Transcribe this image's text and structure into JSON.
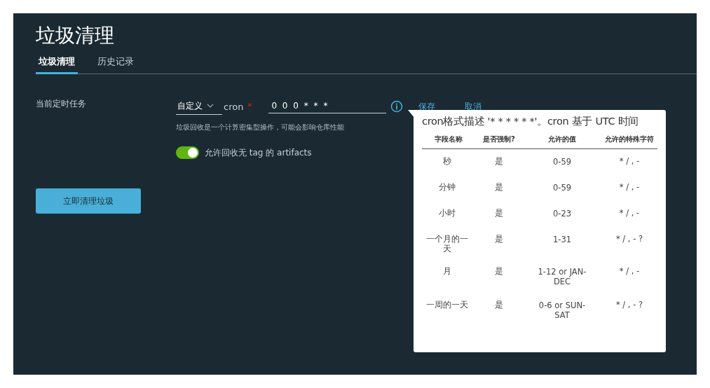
{
  "title": "垃圾清理",
  "tabs": [
    {
      "label": "垃圾清理",
      "selected": true
    },
    {
      "label": "历史记录",
      "selected": false
    }
  ],
  "schedule": {
    "label": "当前定时任务",
    "mode": "自定义",
    "cron_label": "cron",
    "required_mark": "*",
    "cron_value": "0 0 0 * * *",
    "hint": "垃圾回收是一个计算密集型操作，可能会影响仓库性能",
    "save": "保存",
    "cancel": "取消"
  },
  "toggle": {
    "label": "允许回收无 tag 的 artifacts",
    "on": true
  },
  "run_button": "立即清理垃圾",
  "tooltip": {
    "title": "cron格式描述 '* * * * * *'。cron 基于 UTC 时间",
    "columns": [
      "字段名称",
      "是否强制?",
      "允许的值",
      "允许的特殊字符"
    ],
    "rows": [
      [
        "秒",
        "是",
        "0-59",
        "* / , -"
      ],
      [
        "分钟",
        "是",
        "0-59",
        "* / , -"
      ],
      [
        "小时",
        "是",
        "0-23",
        "* / , -"
      ],
      [
        "一个月的一天",
        "是",
        "1-31",
        "* / , - ?"
      ],
      [
        "月",
        "是",
        "1-12 or JAN-DEC",
        "* / , -"
      ],
      [
        "一周的一天",
        "是",
        "0-6 or SUN-SAT",
        "* / , - ?"
      ]
    ]
  }
}
